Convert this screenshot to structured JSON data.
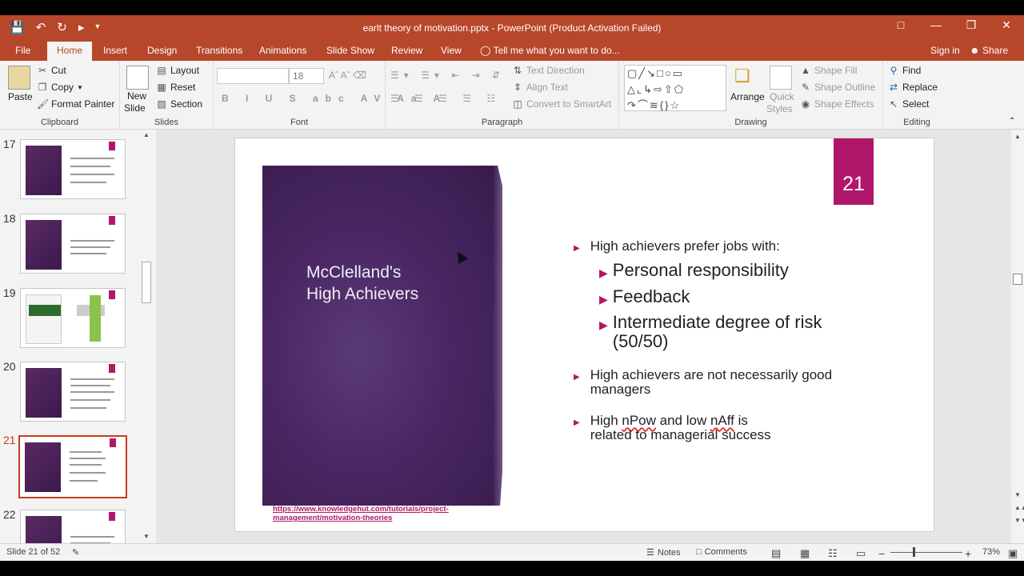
{
  "window": {
    "title": "earlt theory of motivation.pptx - PowerPoint (Product Activation Failed)"
  },
  "qat": {
    "save_icon": "save-icon",
    "undo_icon": "undo-icon",
    "redo_icon": "redo-icon",
    "present_icon": "start-from-beginning-icon"
  },
  "tabs": [
    "File",
    "Home",
    "Insert",
    "Design",
    "Transitions",
    "Animations",
    "Slide Show",
    "Review",
    "View"
  ],
  "active_tab": "Home",
  "tell_me": "Tell me what you want to do...",
  "sign_in": "Sign in",
  "share": "Share",
  "ribbon": {
    "clipboard": {
      "label": "Clipboard",
      "paste": "Paste",
      "cut": "Cut",
      "copy": "Copy",
      "format_painter": "Format Painter"
    },
    "slides": {
      "label": "Slides",
      "new_slide_1": "New",
      "new_slide_2": "Slide",
      "layout": "Layout",
      "reset": "Reset",
      "section": "Section"
    },
    "font": {
      "label": "Font",
      "font_name": "",
      "font_size": "18"
    },
    "paragraph": {
      "label": "Paragraph",
      "text_direction": "Text Direction",
      "align_text": "Align Text",
      "convert_smartart": "Convert to SmartArt"
    },
    "drawing": {
      "label": "Drawing",
      "arrange": "Arrange",
      "quick_styles_1": "Quick",
      "quick_styles_2": "Styles",
      "shape_fill": "Shape Fill",
      "shape_outline": "Shape Outline",
      "shape_effects": "Shape Effects"
    },
    "editing": {
      "label": "Editing",
      "find": "Find",
      "replace": "Replace",
      "select": "Select"
    }
  },
  "thumbnails": [
    {
      "num": "17",
      "selected": false
    },
    {
      "num": "18",
      "selected": false
    },
    {
      "num": "19",
      "selected": false
    },
    {
      "num": "20",
      "selected": false
    },
    {
      "num": "21",
      "selected": true
    },
    {
      "num": "22",
      "selected": false
    }
  ],
  "slide": {
    "number": "21",
    "title": "McClelland's\nHigh Achievers",
    "bullets": [
      {
        "level": 1,
        "text": "High achievers prefer jobs with:"
      },
      {
        "level": 2,
        "text": "Personal responsibility"
      },
      {
        "level": 2,
        "text": "Feedback"
      },
      {
        "level": 2,
        "text": "Intermediate degree of risk (50/50)"
      },
      {
        "level": 1,
        "text": "High achievers are not necessarily good managers"
      },
      {
        "level": 1,
        "text_a": "High ",
        "text_b": "nPow",
        "text_c": " and low ",
        "text_d": "nAff",
        "text_e": " is related to managerial success"
      }
    ],
    "link": "https://www.knowledgehut.com/tutorials/project-management/motivation-theories"
  },
  "status": {
    "slide_of": "Slide 21 of 52",
    "notes": "Notes",
    "comments": "Comments",
    "zoom": "73%"
  },
  "colors": {
    "accent": "#b7472a",
    "badge": "#b0176a",
    "panel": "#4a2763"
  }
}
